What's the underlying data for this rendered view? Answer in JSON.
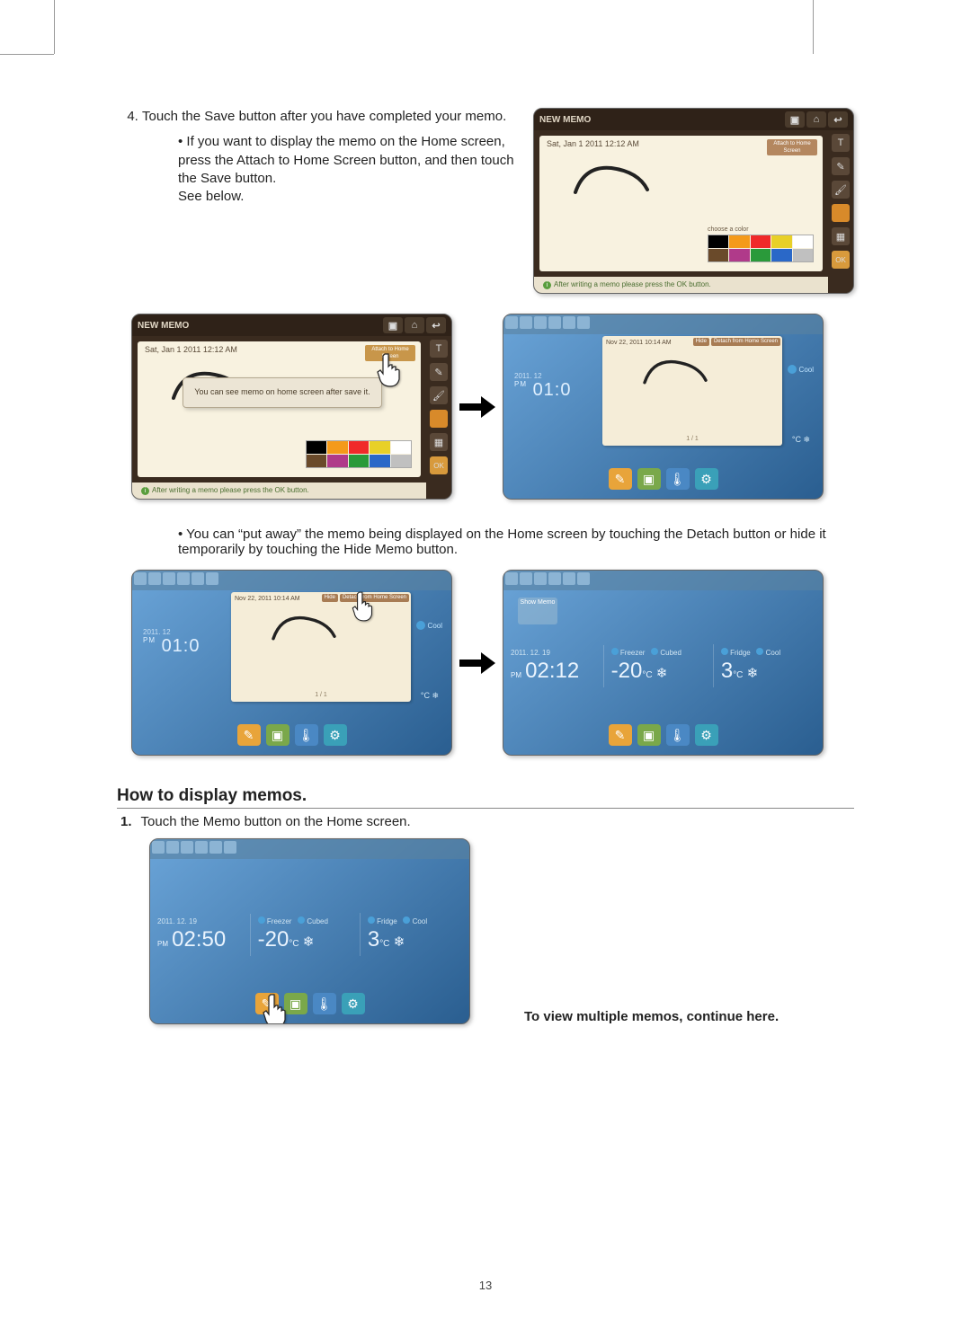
{
  "page_number": "13",
  "step4": {
    "num": "4.",
    "text": "Touch the Save button after you have completed your memo.",
    "bullet1a": "If you want to display the memo on the Home screen, press the Attach to Home Screen button, and then touch the Save button.",
    "bullet1b": "See below.",
    "bullet2": "You can “put away” the memo being displayed on the Home screen by touching the Detach button or hide it temporarily by touching the Hide Memo button."
  },
  "memo_editor": {
    "title": "NEW MEMO",
    "date": "Sat, Jan 1 2011 12:12 AM",
    "attach_label": "Attach to Home Screen",
    "palette_label": "choose a color",
    "footer_text": "After writing a memo please press the OK button.",
    "ok": "OK",
    "popup": "You can see memo on home screen after save it."
  },
  "home": {
    "memo_date": "Nov 22, 2011 10:14 AM",
    "hide_label": "Hide",
    "detach_label": "Detach from Home Screen",
    "page_ind": "1 / 1",
    "status": "Cool",
    "date_a": "2011. 12",
    "time_a_ampm": "PM",
    "time_a": "01:0",
    "unit": "°C",
    "showmemo": "Show Memo",
    "date_b": "2011. 12. 19",
    "time_b": "02:12",
    "time_c": "02:50",
    "freezer_label": "Freezer",
    "cubed_label": "Cubed",
    "fridge_label": "Fridge",
    "cool_label": "Cool",
    "temp_freezer": "-20",
    "temp_fridge": "3",
    "dock": {
      "memo": "Memo",
      "photo": "Photos",
      "temp": "Temperature",
      "settings": "Settings"
    }
  },
  "section2": {
    "heading": "How to display memos.",
    "step1_num": "1.",
    "step1_text": "Touch the Memo button on the Home screen.",
    "continue": "To view multiple memos, continue here."
  },
  "colors": {
    "swatches": [
      "#000000",
      "#f49a1a",
      "#f02a2a",
      "#e8d028",
      "#ffffff",
      "#6a4a2a",
      "#b03a8a",
      "#2a9a3a",
      "#2a68c8",
      "#c0c0c0"
    ]
  }
}
